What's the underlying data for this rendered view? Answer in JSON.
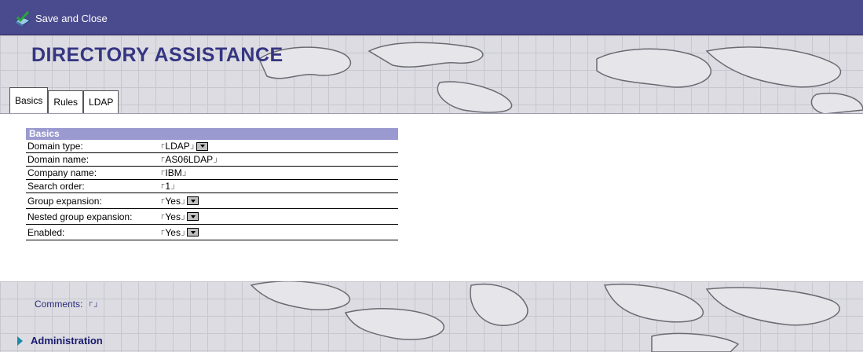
{
  "toolbar": {
    "save_close_label": "Save and Close"
  },
  "header": {
    "title": "DIRECTORY ASSISTANCE"
  },
  "tabs": [
    {
      "label": "Basics",
      "active": true
    },
    {
      "label": "Rules",
      "active": false
    },
    {
      "label": "LDAP",
      "active": false
    }
  ],
  "basics": {
    "section_title": "Basics",
    "rows": [
      {
        "label": "Domain type:",
        "value": "LDAP",
        "dropdown": true
      },
      {
        "label": "Domain name:",
        "value": "AS06LDAP",
        "dropdown": false
      },
      {
        "label": "Company name:",
        "value": "IBM",
        "dropdown": false
      },
      {
        "label": "Search order:",
        "value": "1",
        "dropdown": false
      },
      {
        "label": "Group expansion:",
        "value": "Yes",
        "dropdown": true
      },
      {
        "label": "Nested group expansion:",
        "value": "Yes",
        "dropdown": true
      },
      {
        "label": "Enabled:",
        "value": "Yes",
        "dropdown": true
      }
    ]
  },
  "comments": {
    "label": "Comments:",
    "value": ""
  },
  "administration": {
    "label": "Administration"
  },
  "colors": {
    "toolbar": "#4a4a8e",
    "title": "#353582",
    "section_header": "#9a9ad0"
  }
}
